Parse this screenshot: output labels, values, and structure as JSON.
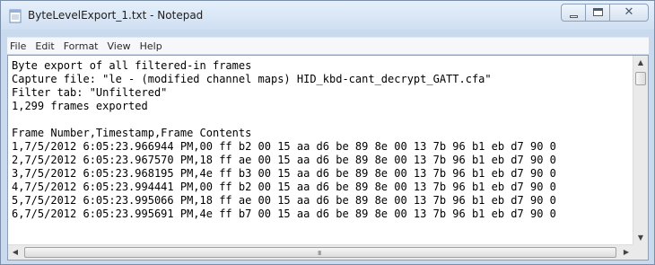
{
  "window": {
    "title": "ByteLevelExport_1.txt - Notepad"
  },
  "icons": {
    "app": "notepad-icon",
    "minimize": "minimize-icon",
    "maximize": "maximize-icon",
    "close": "close-icon",
    "scroll_up": "arrow-up-icon",
    "scroll_down": "arrow-down-icon",
    "scroll_left": "arrow-left-icon",
    "scroll_right": "arrow-right-icon"
  },
  "menu": {
    "items": [
      "File",
      "Edit",
      "Format",
      "View",
      "Help"
    ]
  },
  "editor": {
    "lines": [
      "Byte export of all filtered-in frames",
      "Capture file: \"le - (modified channel maps) HID_kbd-cant_decrypt_GATT.cfa\"",
      "Filter tab: \"Unfiltered\"",
      "1,299 frames exported",
      "",
      "Frame Number,Timestamp,Frame Contents",
      "1,7/5/2012 6:05:23.966944 PM,00 ff b2 00 15 aa d6 be 89 8e 00 13 7b 96 b1 eb d7 90 0",
      "2,7/5/2012 6:05:23.967570 PM,18 ff ae 00 15 aa d6 be 89 8e 00 13 7b 96 b1 eb d7 90 0",
      "3,7/5/2012 6:05:23.968195 PM,4e ff b3 00 15 aa d6 be 89 8e 00 13 7b 96 b1 eb d7 90 0",
      "4,7/5/2012 6:05:23.994441 PM,00 ff b2 00 15 aa d6 be 89 8e 00 13 7b 96 b1 eb d7 90 0",
      "5,7/5/2012 6:05:23.995066 PM,18 ff ae 00 15 aa d6 be 89 8e 00 13 7b 96 b1 eb d7 90 0",
      "6,7/5/2012 6:05:23.995691 PM,4e ff b7 00 15 aa d6 be 89 8e 00 13 7b 96 b1 eb d7 90 0"
    ]
  },
  "scrollbars": {
    "horizontal_grip": "III"
  },
  "colors": {
    "title_bar": "#cfdff2",
    "border": "#7a8ea8",
    "editor_bg": "#ffffff",
    "text": "#000000"
  }
}
